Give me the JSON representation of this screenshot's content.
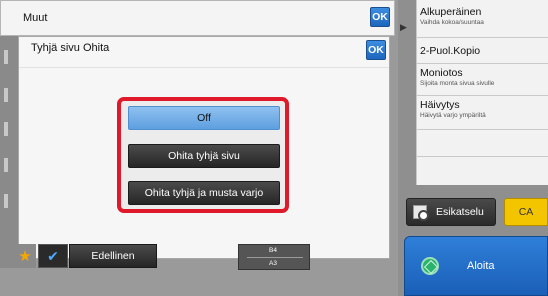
{
  "header": {
    "title": "Muut",
    "ok_label": "OK"
  },
  "dialog": {
    "title": "Tyhjä sivu Ohita",
    "ok_label": "OK",
    "options": [
      {
        "label": "Off",
        "selected": true
      },
      {
        "label": "Ohita tyhjä sivu",
        "selected": false
      },
      {
        "label": "Ohita tyhjä ja musta varjo",
        "selected": false
      }
    ],
    "highlight_color": "#e0192a"
  },
  "menu": {
    "items": [
      {
        "title": "Alkuperäinen",
        "subtitle": "Vaihda kokoa/suuntaa"
      },
      {
        "title": "2-Puol.Kopio",
        "subtitle": ""
      },
      {
        "title": "Moniotos",
        "subtitle": "Sijoita monta sivua sivulle"
      },
      {
        "title": "Häivytys",
        "subtitle": "Häivytä varjo ympäriltä"
      }
    ]
  },
  "actions": {
    "preview_label": "Esikatselu",
    "ca_label": "CA",
    "start_label": "Aloita"
  },
  "bottom": {
    "previous_label": "Edellinen",
    "paper_top": "B4",
    "paper_bottom": "A3"
  },
  "colors": {
    "accent_blue": "#1d66bd",
    "ca_yellow": "#f3c400",
    "start_green": "#2ab36c"
  }
}
